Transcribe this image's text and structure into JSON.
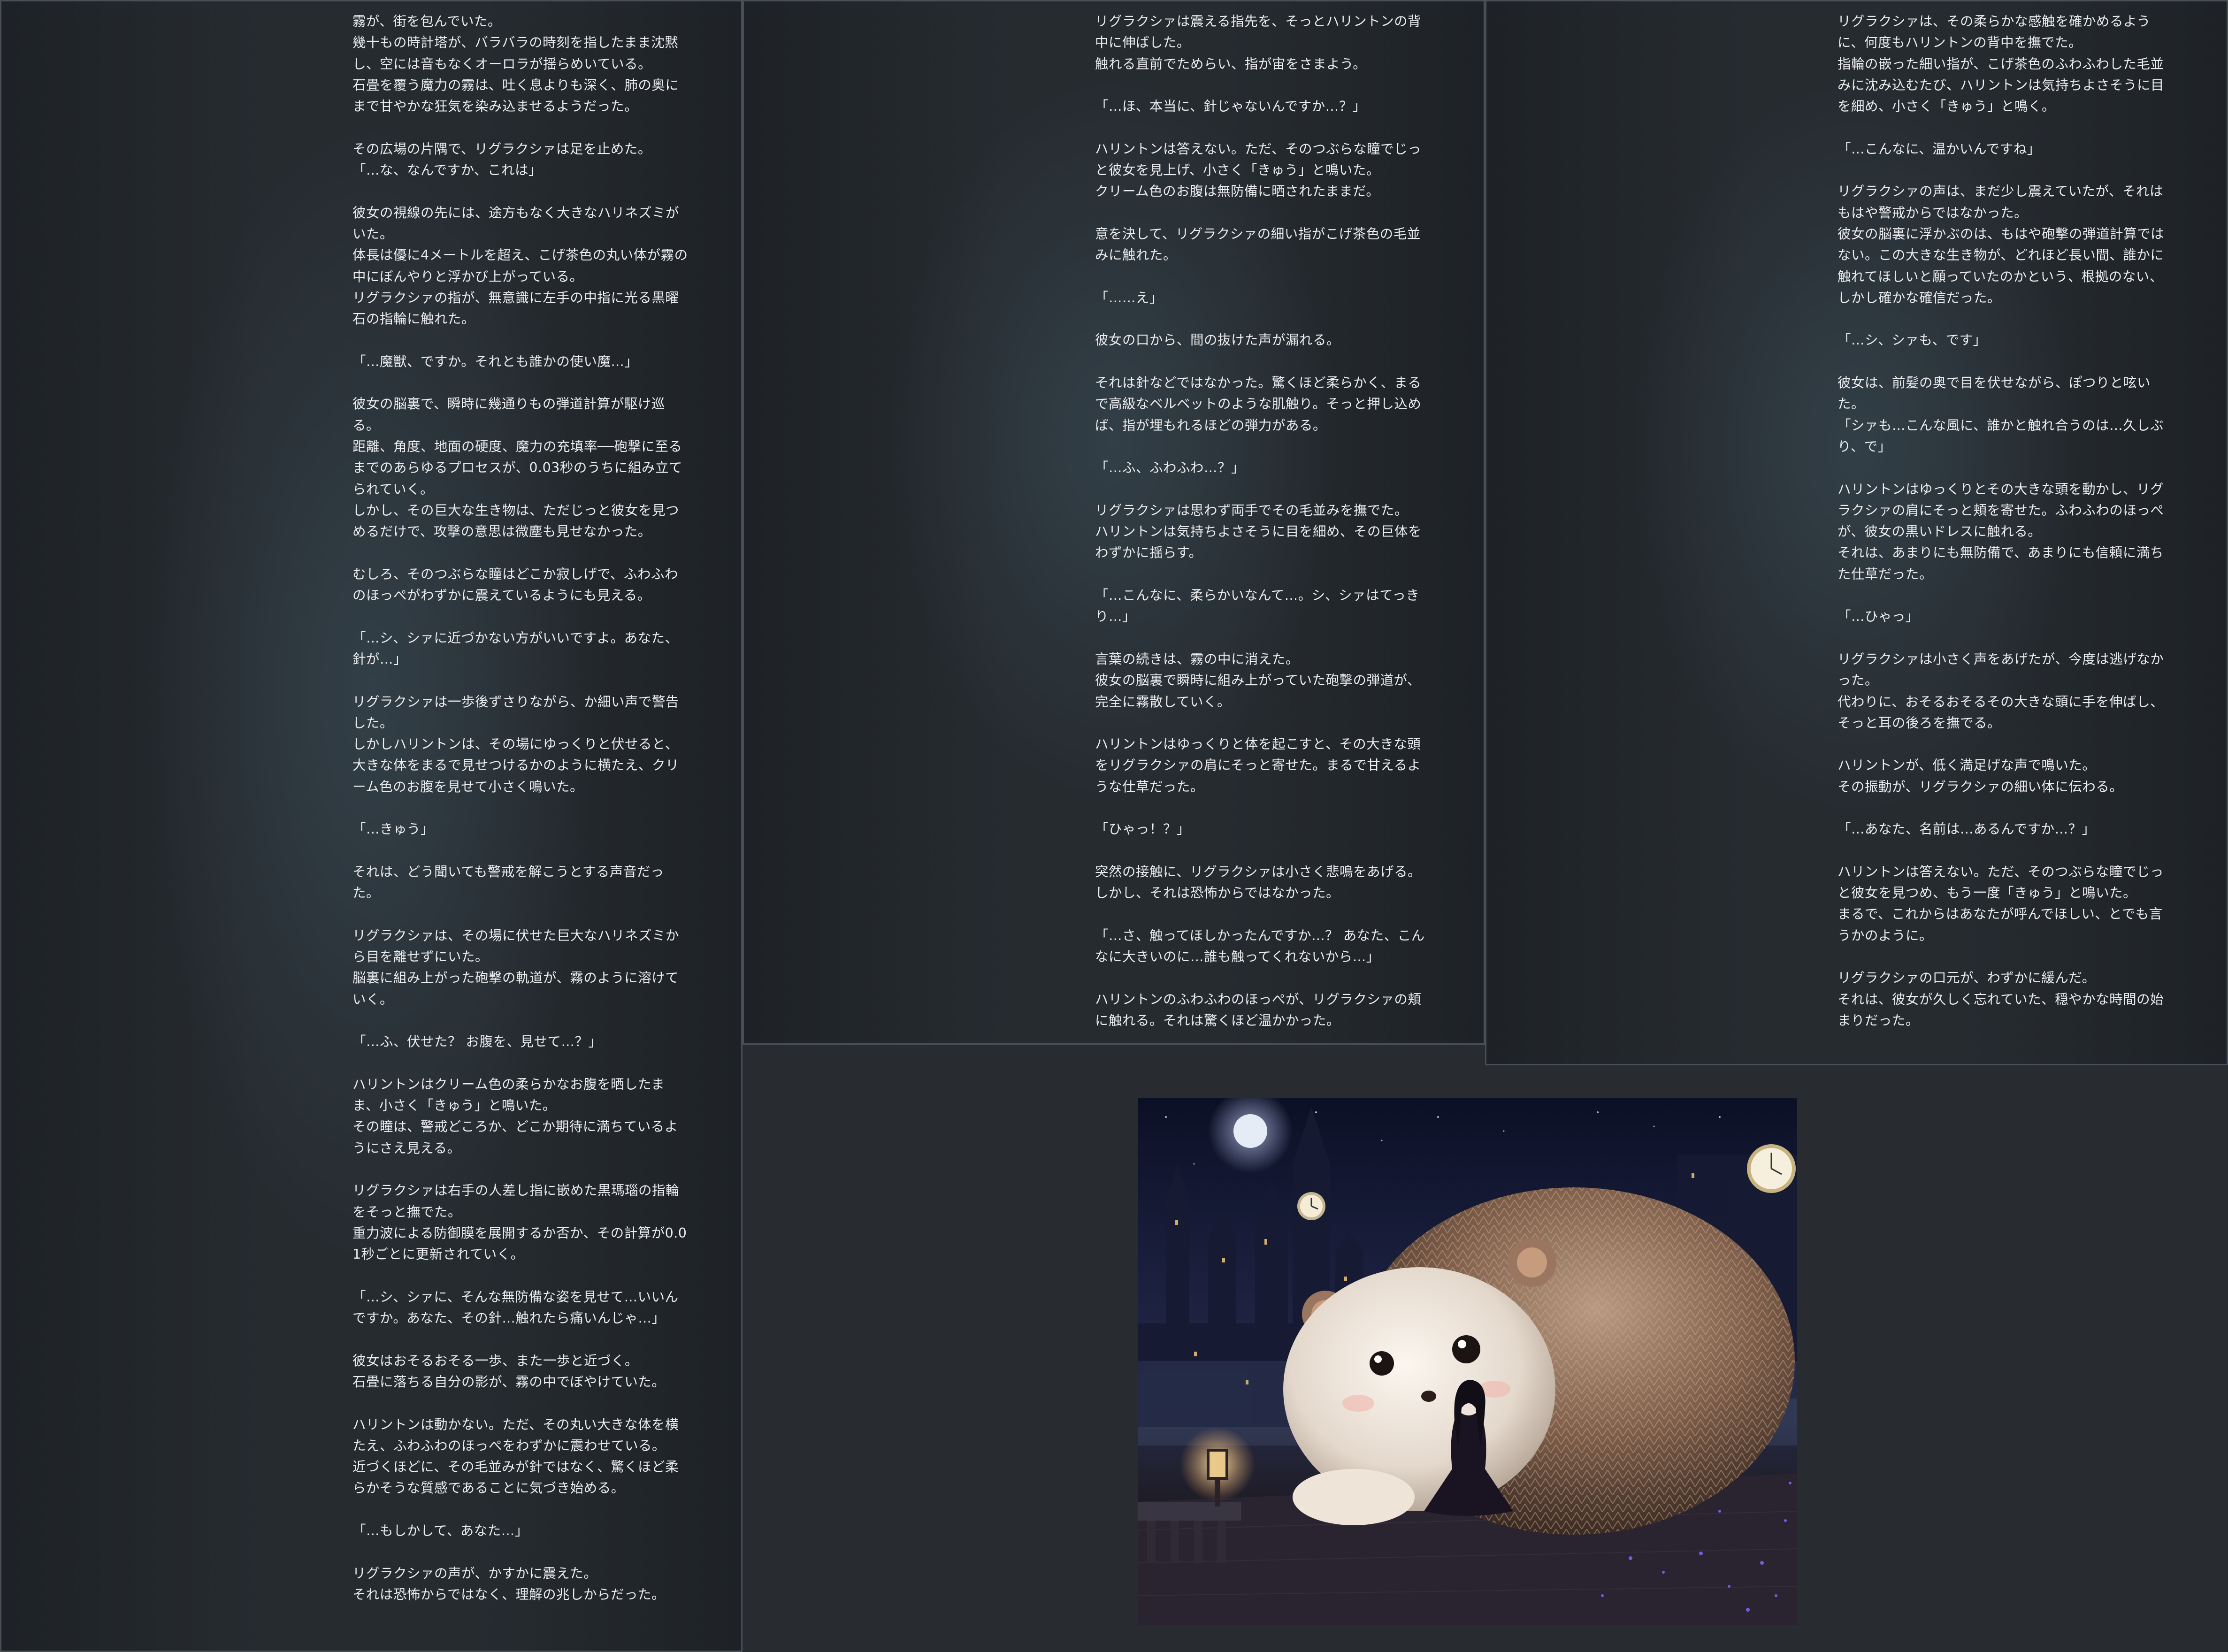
{
  "panels": [
    {
      "paragraphs": [
        [
          "霧が、街を包んでいた。",
          "幾十もの時計塔が、バラバラの時刻を指したまま沈黙し、空には音もなくオーロラが揺らめいている。",
          "石畳を覆う魔力の霧は、吐く息よりも深く、肺の奥にまで甘やかな狂気を染み込ませるようだった。"
        ],
        [
          "その広場の片隅で、リグラクシァは足を止めた。",
          "「…な、なんですか、これは」"
        ],
        [
          "彼女の視線の先には、途方もなく大きなハリネズミがいた。",
          "体長は優に4メートルを超え、こげ茶色の丸い体が霧の中にぼんやりと浮かび上がっている。",
          "リグラクシァの指が、無意識に左手の中指に光る黒曜石の指輪に触れた。"
        ],
        [
          "「…魔獣、ですか。それとも誰かの使い魔…」"
        ],
        [
          "彼女の脳裏で、瞬時に幾通りもの弾道計算が駆け巡る。",
          "距離、角度、地面の硬度、魔力の充填率──砲撃に至るまでのあらゆるプロセスが、0.03秒のうちに組み立てられていく。",
          "しかし、その巨大な生き物は、ただじっと彼女を見つめるだけで、攻撃の意思は微塵も見せなかった。"
        ],
        [
          "むしろ、そのつぶらな瞳はどこか寂しげで、ふわふわのほっぺがわずかに震えているようにも見える。"
        ],
        [
          "「…シ、シァに近づかない方がいいですよ。あなた、針が…」"
        ],
        [
          "リグラクシァは一歩後ずさりながら、か細い声で警告した。",
          "しかしハリントンは、その場にゆっくりと伏せると、大きな体をまるで見せつけるかのように横たえ、クリーム色のお腹を見せて小さく鳴いた。"
        ],
        [
          "「…きゅう」"
        ],
        [
          "それは、どう聞いても警戒を解こうとする声音だった。"
        ],
        [
          "リグラクシァは、その場に伏せた巨大なハリネズミから目を離せずにいた。",
          "脳裏に組み上がった砲撃の軌道が、霧のように溶けていく。"
        ],
        [
          "「…ふ、伏せた？ お腹を、見せて…？」"
        ],
        [
          "ハリントンはクリーム色の柔らかなお腹を晒したまま、小さく「きゅう」と鳴いた。",
          "その瞳は、警戒どころか、どこか期待に満ちているようにさえ見える。"
        ],
        [
          "リグラクシァは右手の人差し指に嵌めた黒瑪瑙の指輪をそっと撫でた。",
          "重力波による防御膜を展開するか否か、その計算が0.01秒ごとに更新されていく。"
        ],
        [
          "「…シ、シァに、そんな無防備な姿を見せて…いいんですか。あなた、その針…触れたら痛いんじゃ…」"
        ],
        [
          "彼女はおそるおそる一歩、また一歩と近づく。",
          "石畳に落ちる自分の影が、霧の中でぼやけていた。"
        ],
        [
          "ハリントンは動かない。ただ、その丸い大きな体を横たえ、ふわふわのほっぺをわずかに震わせている。",
          "近づくほどに、その毛並みが針ではなく、驚くほど柔らかそうな質感であることに気づき始める。"
        ],
        [
          "「…もしかして、あなた…」"
        ],
        [
          "リグラクシァの声が、かすかに震えた。",
          "それは恐怖からではなく、理解の兆しからだった。"
        ]
      ]
    },
    {
      "paragraphs": [
        [
          "リグラクシァは震える指先を、そっとハリントンの背中に伸ばした。",
          "触れる直前でためらい、指が宙をさまよう。"
        ],
        [
          "「…ほ、本当に、針じゃないんですか…？」"
        ],
        [
          "ハリントンは答えない。ただ、そのつぶらな瞳でじっと彼女を見上げ、小さく「きゅう」と鳴いた。",
          "クリーム色のお腹は無防備に晒されたままだ。"
        ],
        [
          "意を決して、リグラクシァの細い指がこげ茶色の毛並みに触れた。"
        ],
        [
          "「……え」"
        ],
        [
          "彼女の口から、間の抜けた声が漏れる。"
        ],
        [
          "それは針などではなかった。驚くほど柔らかく、まるで高級なベルベットのような肌触り。そっと押し込めば、指が埋もれるほどの弾力がある。"
        ],
        [
          "「…ふ、ふわふわ…？」"
        ],
        [
          "リグラクシァは思わず両手でその毛並みを撫でた。",
          "ハリントンは気持ちよさそうに目を細め、その巨体をわずかに揺らす。"
        ],
        [
          "「…こんなに、柔らかいなんて…。シ、シァはてっきり…」"
        ],
        [
          "言葉の続きは、霧の中に消えた。",
          "彼女の脳裏で瞬時に組み上がっていた砲撃の弾道が、完全に霧散していく。"
        ],
        [
          "ハリントンはゆっくりと体を起こすと、その大きな頭をリグラクシァの肩にそっと寄せた。まるで甘えるような仕草だった。"
        ],
        [
          "「ひゃっ！？」"
        ],
        [
          "突然の接触に、リグラクシァは小さく悲鳴をあげる。しかし、それは恐怖からではなかった。"
        ],
        [
          "「…さ、触ってほしかったんですか…？ あなた、こんなに大きいのに…誰も触ってくれないから…」"
        ],
        [
          "ハリントンのふわふわのほっぺが、リグラクシァの頬に触れる。それは驚くほど温かかった。"
        ]
      ]
    },
    {
      "paragraphs": [
        [
          "リグラクシァは、その柔らかな感触を確かめるように、何度もハリントンの背中を撫でた。",
          "指輪の嵌った細い指が、こげ茶色のふわふわした毛並みに沈み込むたび、ハリントンは気持ちよさそうに目を細め、小さく「きゅう」と鳴く。"
        ],
        [
          "「…こんなに、温かいんですね」"
        ],
        [
          "リグラクシァの声は、まだ少し震えていたが、それはもはや警戒からではなかった。",
          "彼女の脳裏に浮かぶのは、もはや砲撃の弾道計算ではない。この大きな生き物が、どれほど長い間、誰かに触れてほしいと願っていたのかという、根拠のない、しかし確かな確信だった。"
        ],
        [
          "「…シ、シァも、です」"
        ],
        [
          "彼女は、前髪の奥で目を伏せながら、ぽつりと呟いた。",
          "「シァも…こんな風に、誰かと触れ合うのは…久しぶり、で」"
        ],
        [
          "ハリントンはゆっくりとその大きな頭を動かし、リグラクシァの肩にそっと頬を寄せた。ふわふわのほっぺが、彼女の黒いドレスに触れる。",
          "それは、あまりにも無防備で、あまりにも信頼に満ちた仕草だった。"
        ],
        [
          "「…ひゃっ」"
        ],
        [
          "リグラクシァは小さく声をあげたが、今度は逃げなかった。",
          "代わりに、おそるおそるその大きな頭に手を伸ばし、そっと耳の後ろを撫でる。"
        ],
        [
          "ハリントンが、低く満足げな声で鳴いた。",
          "その振動が、リグラクシァの細い体に伝わる。"
        ],
        [
          "「…あなた、名前は…あるんですか…？」"
        ],
        [
          "ハリントンは答えない。ただ、そのつぶらな瞳でじっと彼女を見つめ、もう一度「きゅう」と鳴いた。",
          "まるで、これからはあなたが呼んでほしい、とでも言うかのように。"
        ],
        [
          "リグラクシァの口元が、わずかに緩んだ。",
          "それは、彼女が久しく忘れていた、穏やかな時間の始まりだった。"
        ]
      ]
    }
  ],
  "illustration": {
    "subject": "giant-hedgehog-and-girl-in-misty-clocktower-city",
    "colors": {
      "sky": "#121733",
      "moon": "#e6ecf5",
      "hedgehog_fur": "#8a6a55",
      "hedgehog_face": "#efe6dc",
      "aura": "#6b5cff"
    }
  }
}
